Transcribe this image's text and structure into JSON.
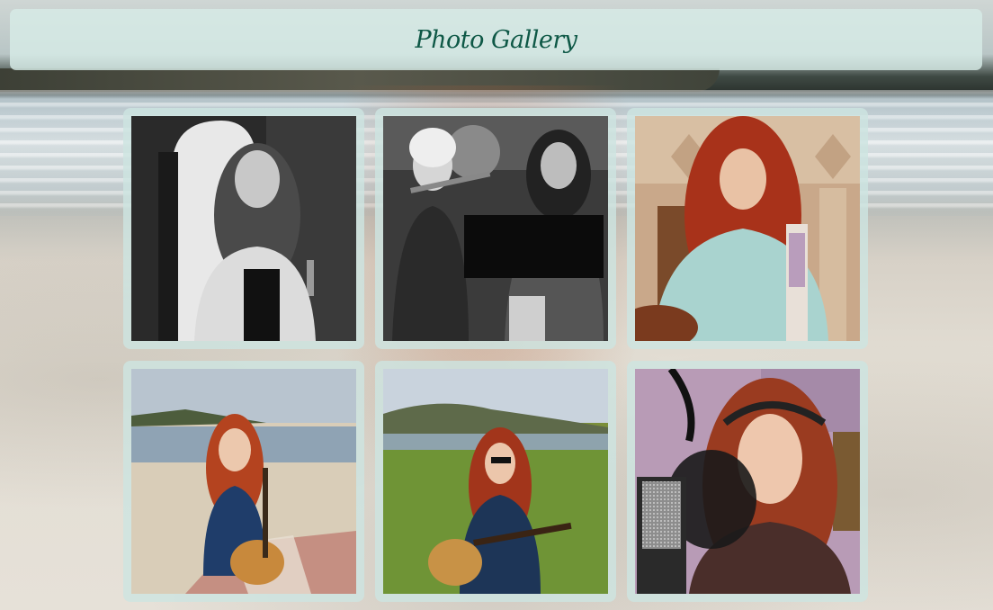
{
  "header": {
    "title": "Photo Gallery"
  },
  "gallery": {
    "photos": [
      {
        "name": "bw-doorway-portrait",
        "style": "black-and-white"
      },
      {
        "name": "bw-duo-violin",
        "style": "black-and-white"
      },
      {
        "name": "guitar-by-fireplace",
        "style": "color"
      },
      {
        "name": "beach-picnic-guitar",
        "style": "color"
      },
      {
        "name": "field-guitar-mountains",
        "style": "color"
      },
      {
        "name": "studio-microphone",
        "style": "color"
      }
    ]
  },
  "colors": {
    "header_background": "#d7ebe6",
    "title_color": "#0e5846",
    "tile_background": "#cde4e1"
  }
}
